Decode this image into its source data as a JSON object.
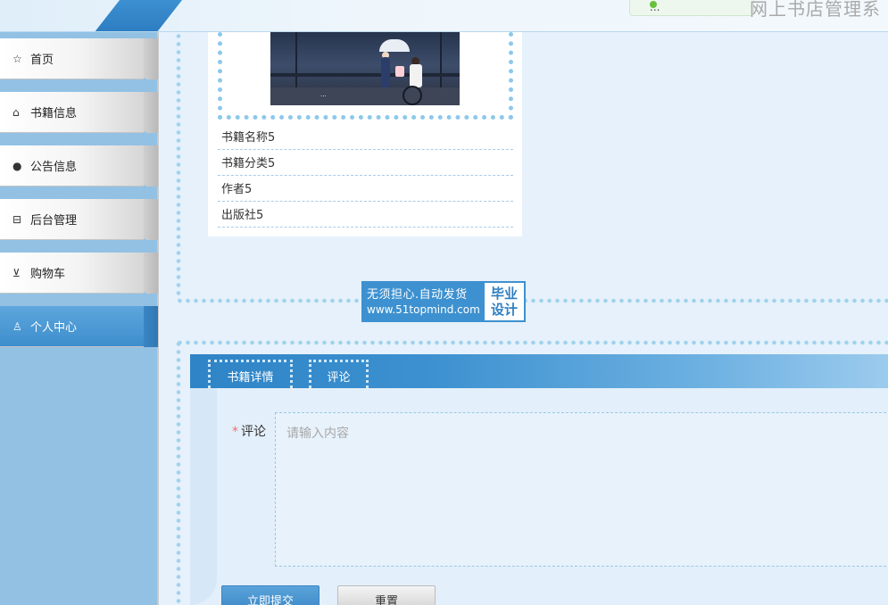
{
  "header": {
    "user_chip_text": "...",
    "site_title": "网上书店管理系"
  },
  "sidebar": {
    "items": [
      {
        "label": "首页",
        "icon": "star-icon"
      },
      {
        "label": "书籍信息",
        "icon": "bag-icon"
      },
      {
        "label": "公告信息",
        "icon": "alert-circle-icon"
      },
      {
        "label": "后台管理",
        "icon": "briefcase-icon"
      },
      {
        "label": "购物车",
        "icon": "cart-icon"
      },
      {
        "label": "个人中心",
        "icon": "user-icon",
        "active": true
      }
    ]
  },
  "book": {
    "cover_caption": "...",
    "name": "书籍名称5",
    "category": "书籍分类5",
    "author": "作者5",
    "publisher": "出版社5"
  },
  "ad": {
    "line1": "无须担心.自动发货",
    "line2": "www.51topmind.com",
    "right_line1": "毕业",
    "right_line2": "设计"
  },
  "tabs": [
    {
      "label": "书籍详情",
      "active": false
    },
    {
      "label": "评论",
      "active": true
    }
  ],
  "comment_form": {
    "required_mark": "*",
    "label": "评论",
    "placeholder": "请输入内容",
    "value": ""
  },
  "buttons": {
    "submit_label": "立即提交",
    "reset_label": "重置"
  },
  "colors": {
    "accent": "#3d91d0",
    "sidebar_bg": "#92c1e4",
    "page_bg": "#e6f1fb",
    "dots": "#9fd3ec",
    "required": "#f56c6c"
  }
}
